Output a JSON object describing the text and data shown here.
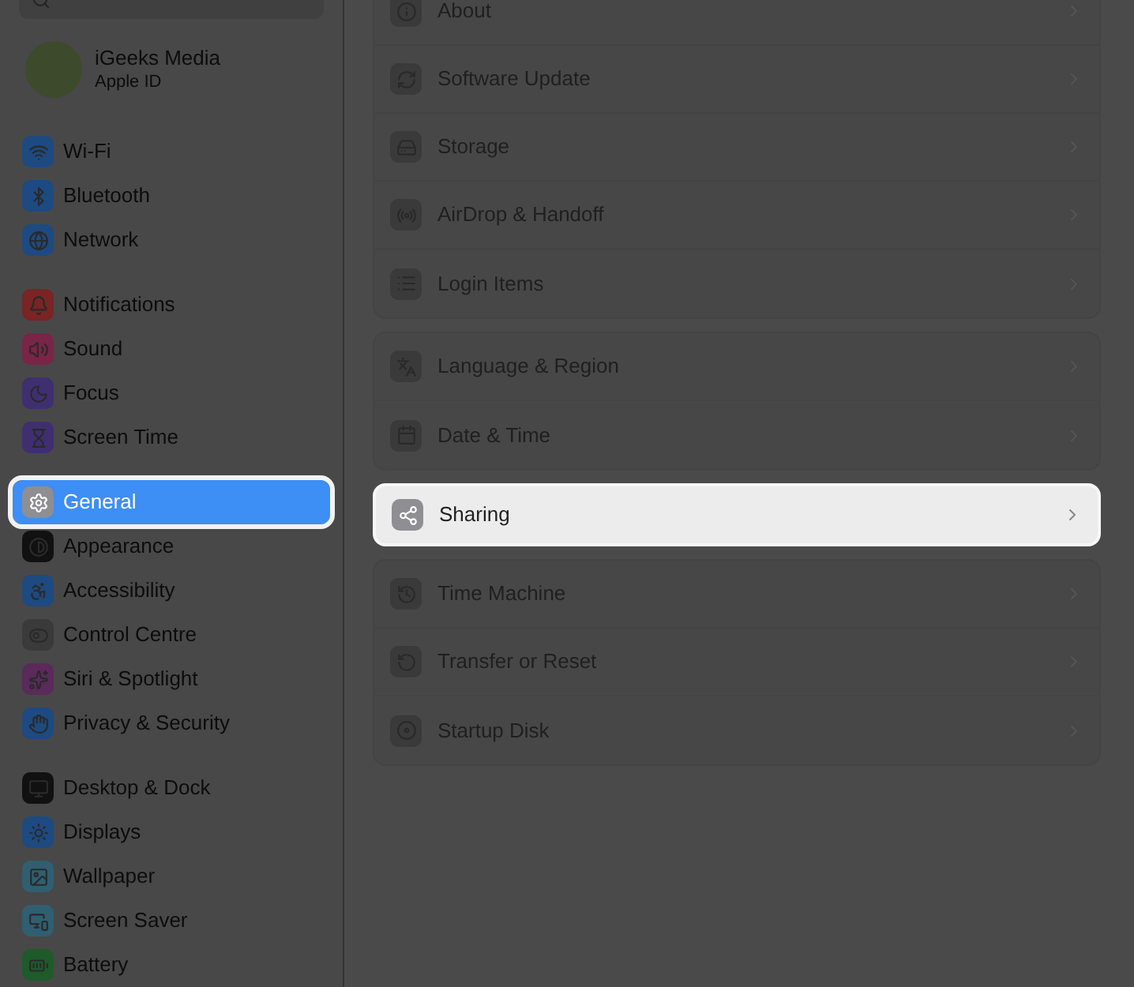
{
  "sidebar": {
    "profile": {
      "name": "iGeeks Media",
      "subtitle": "Apple ID"
    },
    "groups": [
      [
        {
          "label": "Wi-Fi",
          "selected": false,
          "color": "#1d4a80"
        },
        {
          "label": "Bluetooth",
          "selected": false,
          "color": "#1d4a80"
        },
        {
          "label": "Network",
          "selected": false,
          "color": "#1d4a80"
        }
      ],
      [
        {
          "label": "Notifications",
          "selected": false,
          "color": "#7a2424"
        },
        {
          "label": "Sound",
          "selected": false,
          "color": "#7a2448"
        },
        {
          "label": "Focus",
          "selected": false,
          "color": "#3f2f70"
        },
        {
          "label": "Screen Time",
          "selected": false,
          "color": "#3f2f70"
        }
      ],
      [
        {
          "label": "General",
          "selected": true,
          "color": "#8e8e93"
        },
        {
          "label": "Appearance",
          "selected": false,
          "color": "#111111"
        },
        {
          "label": "Accessibility",
          "selected": false,
          "color": "#1d4a80"
        },
        {
          "label": "Control Centre",
          "selected": false,
          "color": "#3a3a3a"
        },
        {
          "label": "Siri & Spotlight",
          "selected": false,
          "color": "#5a2a5a"
        },
        {
          "label": "Privacy & Security",
          "selected": false,
          "color": "#1d4a80"
        }
      ],
      [
        {
          "label": "Desktop & Dock",
          "selected": false,
          "color": "#111111"
        },
        {
          "label": "Displays",
          "selected": false,
          "color": "#1d4a80"
        },
        {
          "label": "Wallpaper",
          "selected": false,
          "color": "#2f5f70"
        },
        {
          "label": "Screen Saver",
          "selected": false,
          "color": "#2f5f70"
        },
        {
          "label": "Battery",
          "selected": false,
          "color": "#1f5a2a"
        }
      ]
    ]
  },
  "main": {
    "groups": [
      [
        {
          "label": "About",
          "highlighted": false
        },
        {
          "label": "Software Update",
          "highlighted": false
        },
        {
          "label": "Storage",
          "highlighted": false
        },
        {
          "label": "AirDrop & Handoff",
          "highlighted": false
        },
        {
          "label": "Login Items",
          "highlighted": false
        }
      ],
      [
        {
          "label": "Language & Region",
          "highlighted": false
        },
        {
          "label": "Date & Time",
          "highlighted": false
        }
      ],
      [
        {
          "label": "Sharing",
          "highlighted": true
        }
      ],
      [
        {
          "label": "Time Machine",
          "highlighted": false
        },
        {
          "label": "Transfer or Reset",
          "highlighted": false
        },
        {
          "label": "Startup Disk",
          "highlighted": false
        }
      ]
    ]
  }
}
